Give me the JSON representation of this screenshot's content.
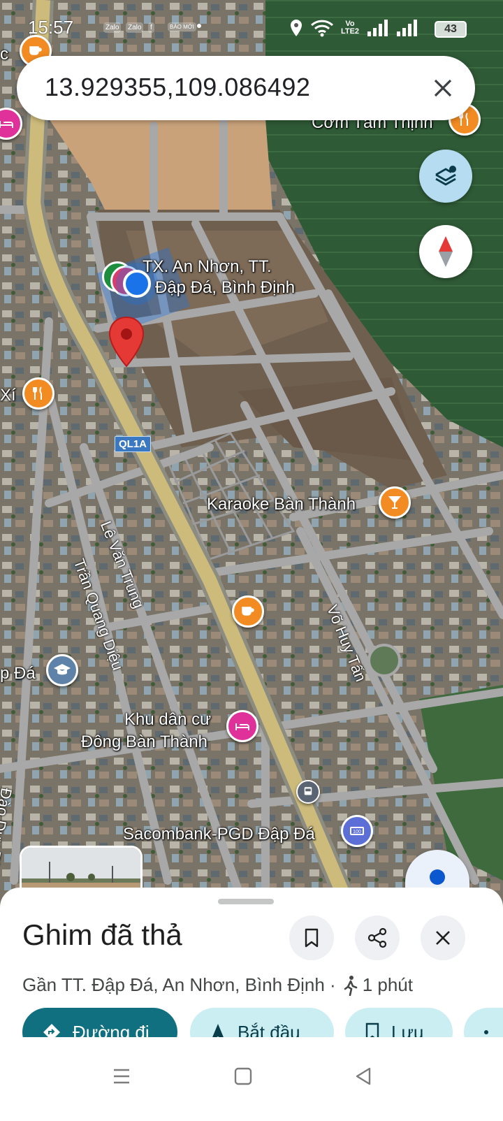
{
  "status_bar": {
    "time": "15:57",
    "notifications": [
      "Zalo",
      "Zalo",
      "f",
      "BÁO MỚI"
    ],
    "network": "Vo LTE2",
    "battery": "43"
  },
  "search": {
    "query": "13.929355,109.086492"
  },
  "map": {
    "place_labels": {
      "pin_area": "TX. An Nhơn, TT.",
      "pin_area_2": "Đập Đá, Bình Định",
      "com_tam": "Cơm Tấm Thịnh",
      "karaoke": "Karaoke Bàn Thành",
      "khu_dan_cu_1": "Khu dân cư",
      "khu_dan_cu_2": "Đông Bàn Thành",
      "sacombank": "Sacombank-PGD Đập Đá",
      "edge_c": "c",
      "edge_xi": "Xí",
      "edge_pda": "p Đá"
    },
    "street_labels": {
      "le_van_trung": "Lê Văn Trung",
      "tran_quang_dieu": "Trần Quang Diệu",
      "vo_huy_tan": "Võ Huy Tấn",
      "dao_duy_tu": "Đào Duy Từ"
    },
    "route_badge": "QL1A",
    "colors": {
      "pin": "#e53935",
      "location_dot": "#1a73e8",
      "poi_food": "#f28b22",
      "poi_hotel": "#e0319a",
      "poi_school": "#5f83a8",
      "poi_bank": "#5b6fd6",
      "road_main": "#cdbb7c",
      "road_minor": "#a8a8a8"
    }
  },
  "sheet": {
    "title": "Ghim đã thả",
    "address": "Gần TT. Đập Đá, An Nhơn, Bình Định ·",
    "walk_time": "1 phút",
    "chips": {
      "directions": "Đường đi",
      "start": "Bắt đầu",
      "save": "Lưu"
    }
  }
}
